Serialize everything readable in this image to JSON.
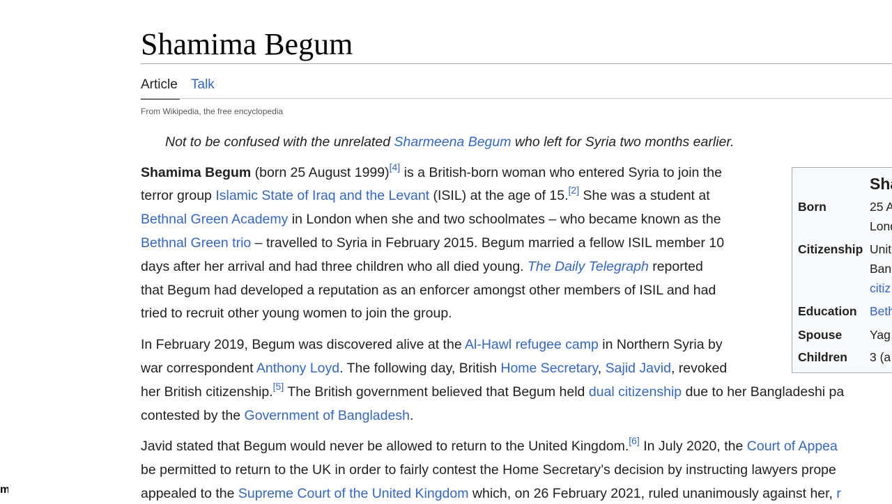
{
  "title": "Shamima Begum",
  "tabs": {
    "article": "Article",
    "talk": "Talk"
  },
  "tagline": "From Wikipedia, the free encyclopedia",
  "hatnote": {
    "pre": "Not to be confused with the unrelated ",
    "link": "Sharmeena Begum",
    "post": " who left for Syria two months earlier."
  },
  "p1": {
    "l1_bold": "Shamima Begum",
    "l1_a": " (born 25 August 1999)",
    "l1_ref": "[4]",
    "l1_b": " is a British-born woman who entered Syria to join the",
    "l2_a": "terror group ",
    "l2_link": "Islamic State of Iraq and the Levant",
    "l2_b": " (ISIL) at the age of 15.",
    "l2_ref": "[2]",
    "l2_c": " She was a student at",
    "l3_link": "Bethnal Green Academy",
    "l3_b": " in London when she and two schoolmates – who became known as the",
    "l4_link": "Bethnal Green trio",
    "l4_b": " – travelled to Syria in February 2015. Begum married a fellow ISIL member 10",
    "l5_a": "days after her arrival and had three children who all died young. ",
    "l5_link": "The Daily Telegraph",
    "l5_b": " reported",
    "l6": "that Begum had developed a reputation as an enforcer amongst other members of ISIL and had",
    "l7": "tried to recruit other young women to join the group."
  },
  "p2": {
    "l1_a": "In February 2019, Begum was discovered alive at the ",
    "l1_link": "Al-Hawl refugee camp",
    "l1_b": " in Northern Syria by",
    "l2_a": "war correspondent ",
    "l2_link1": "Anthony Loyd",
    "l2_b": ". The following day, British ",
    "l2_link2": "Home Secretary",
    "l2_c": ", ",
    "l2_link3": "Sajid Javid",
    "l2_d": ", revoked",
    "l3_a": "her British citizenship.",
    "l3_ref": "[5]",
    "l3_b": " The British government believed that Begum held ",
    "l3_link": "dual citizenship",
    "l3_c": " due to her Bangladeshi pa",
    "l4_a": "contested by the ",
    "l4_link": "Government of Bangladesh",
    "l4_b": "."
  },
  "p3": {
    "l1_a": "Javid stated that Begum would never be allowed to return to the United Kingdom.",
    "l1_ref": "[6]",
    "l1_b": " In July 2020, the ",
    "l1_link": "Court of Appea",
    "l2": "be permitted to return to the UK in order to fairly contest the Home Secretary’s decision by instructing lawyers prope",
    "l3_a": "appealed to the ",
    "l3_link": "Supreme Court of the United Kingdom",
    "l3_b": " which, on 26 February 2021, ruled unanimously against her, ",
    "l3_link2": "r"
  },
  "infobox": {
    "title": "Sha",
    "rows": [
      {
        "label": "Born",
        "values": [
          "25 A",
          "Lond"
        ]
      },
      {
        "label": "Citizenship",
        "values": [
          "Unit",
          "Ban",
          "citiz"
        ]
      },
      {
        "label": "Education",
        "values": [
          "Beth"
        ]
      },
      {
        "label": "Spouse",
        "values": [
          "Yag"
        ]
      },
      {
        "label": "Children",
        "values": [
          "3 (a"
        ]
      }
    ]
  },
  "edge_glyph": "m"
}
